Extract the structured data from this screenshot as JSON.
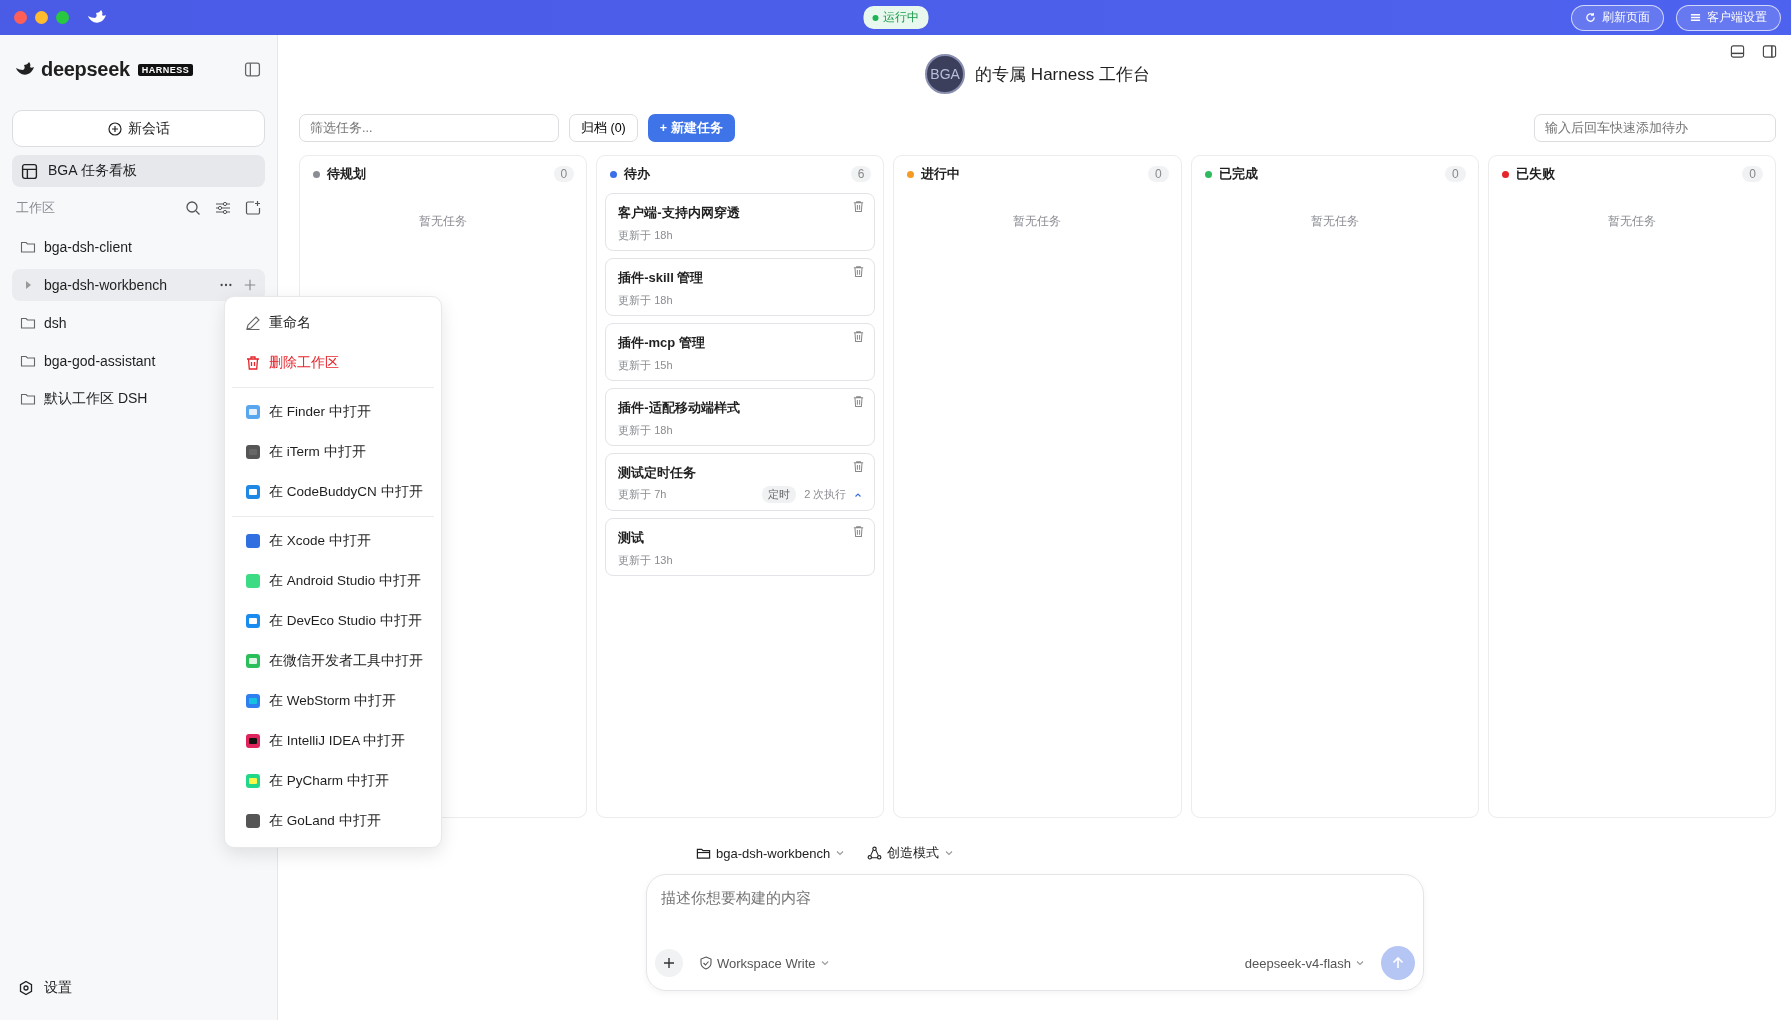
{
  "titlebar": {
    "status": "运行中",
    "buttons": [
      "刷新页面",
      "客户端设置"
    ]
  },
  "sidebar": {
    "logo": "deepseek",
    "badge": "HARNESS",
    "new_chat": "新会话",
    "board_item": {
      "label": "BGA 任务看板",
      "selected": true
    },
    "section_title": "工作区",
    "workspaces": [
      {
        "name": "bga-dsh-client",
        "kind": "folder",
        "selected": false
      },
      {
        "name": "bga-dsh-workbench",
        "kind": "expandable",
        "selected": true
      },
      {
        "name": "dsh",
        "kind": "folder",
        "selected": false
      },
      {
        "name": "bga-god-assistant",
        "kind": "folder",
        "selected": false
      },
      {
        "name": "默认工作区 DSH",
        "kind": "folder",
        "selected": false
      }
    ],
    "settings": "设置"
  },
  "context_menu": {
    "groups": [
      [
        {
          "label": "重命名",
          "kind": "normal"
        },
        {
          "label": "删除工作区",
          "kind": "danger"
        }
      ],
      [
        {
          "label": "在 Finder 中打开",
          "kind": "normal"
        },
        {
          "label": "在 iTerm 中打开",
          "kind": "normal"
        },
        {
          "label": "在 CodeBuddyCN 中打开",
          "kind": "normal"
        }
      ],
      [
        {
          "label": "在 Xcode 中打开",
          "kind": "normal"
        },
        {
          "label": "在 Android Studio 中打开",
          "kind": "normal"
        },
        {
          "label": "在 DevEco Studio 中打开",
          "kind": "normal"
        },
        {
          "label": "在微信开发者工具中打开",
          "kind": "normal"
        },
        {
          "label": "在 WebStorm 中打开",
          "kind": "normal"
        },
        {
          "label": "在 IntelliJ IDEA 中打开",
          "kind": "normal"
        },
        {
          "label": "在 PyCharm 中打开",
          "kind": "normal"
        },
        {
          "label": "在 GoLand 中打开",
          "kind": "normal"
        }
      ]
    ]
  },
  "header": {
    "avatar": "BGA",
    "title": "的专属 Harness 工作台"
  },
  "toolbar": {
    "filter_placeholder": "筛选任务...",
    "archive": "归档 (0)",
    "new_task": "+ 新建任务",
    "quick_add_placeholder": "输入后回车快速添加待办"
  },
  "columns": [
    {
      "name": "待规划",
      "count": "0",
      "color": "#8a8d94",
      "empty": "暂无任务"
    },
    {
      "name": "待办",
      "count": "6",
      "color": "#3b6fe8",
      "tasks": [
        {
          "title": "客户端-支持内网穿透",
          "updated": "更新于 18h"
        },
        {
          "title": "插件-skill 管理",
          "updated": "更新于 18h"
        },
        {
          "title": "插件-mcp 管理",
          "updated": "更新于 15h"
        },
        {
          "title": "插件-适配移动端样式",
          "updated": "更新于 18h"
        },
        {
          "title": "测试定时任务",
          "updated": "更新于 7h",
          "tag": "定时",
          "runs": "2 次执行"
        },
        {
          "title": "测试",
          "updated": "更新于 13h"
        }
      ]
    },
    {
      "name": "进行中",
      "count": "0",
      "color": "#f59a23",
      "empty": "暂无任务"
    },
    {
      "name": "已完成",
      "count": "0",
      "color": "#2dbb5e",
      "empty": "暂无任务"
    },
    {
      "name": "已失败",
      "count": "0",
      "color": "#e5242b",
      "empty": "暂无任务"
    }
  ],
  "composer": {
    "workspace": "bga-dsh-workbench",
    "mode": "创造模式",
    "placeholder": "描述你想要构建的内容",
    "permission": "Workspace Write",
    "model": "deepseek-v4-flash"
  }
}
